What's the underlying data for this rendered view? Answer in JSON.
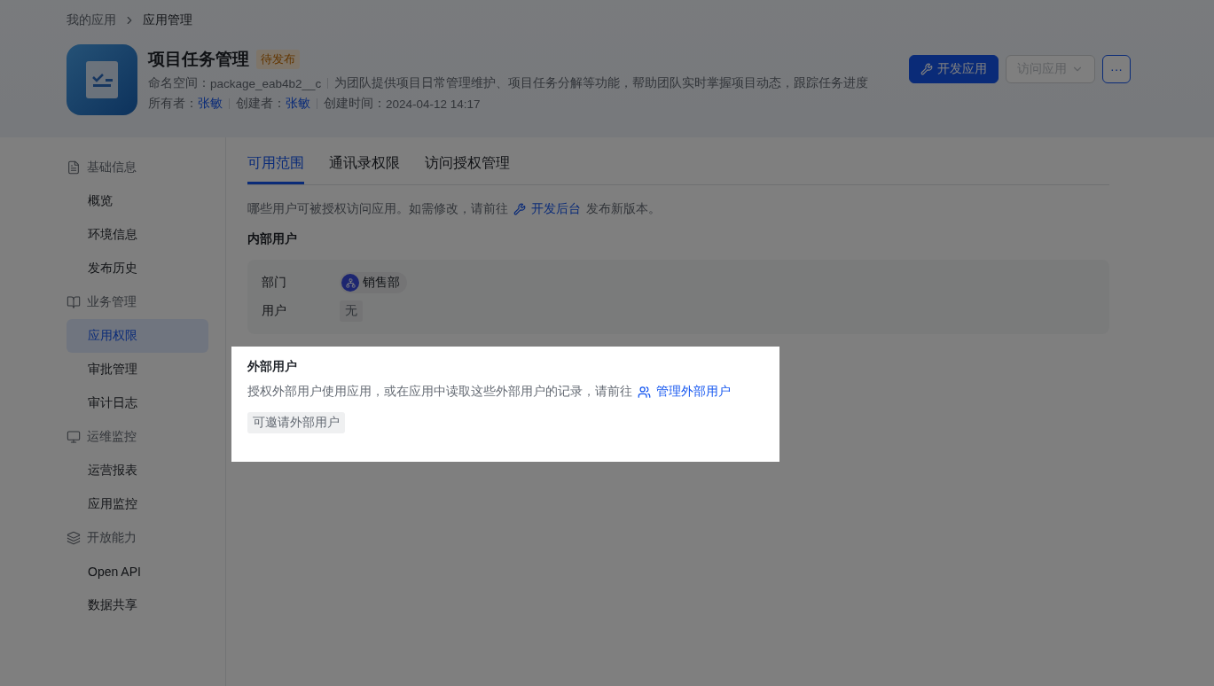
{
  "breadcrumb": [
    "我的应用",
    "应用管理"
  ],
  "app": {
    "name": "项目任务管理",
    "status": "待发布",
    "namespace_label": "命名空间：",
    "namespace": "package_eab4b2__c",
    "description": "为团队提供项目日常管理维护、项目任务分解等功能，帮助团队实时掌握项目动态，跟踪任务进度",
    "owner_label": "所有者：",
    "owner": "张敏",
    "creator_label": "创建者：",
    "creator": "张敏",
    "created_label": "创建时间：",
    "created": "2024-04-12 14:17"
  },
  "actions": [
    {
      "kind": "primary",
      "label": "开发应用",
      "disabled": false
    },
    {
      "kind": "dropdown",
      "label": "访问应用",
      "disabled": true
    },
    {
      "kind": "more",
      "label": "···",
      "disabled": false
    }
  ],
  "sidebar": [
    {
      "kind": "doc",
      "label": "基础信息",
      "items": [
        {
          "label": "概览",
          "selected": false
        },
        {
          "label": "环境信息",
          "selected": false
        },
        {
          "label": "发布历史",
          "selected": false
        }
      ]
    },
    {
      "kind": "book",
      "label": "业务管理",
      "items": [
        {
          "label": "应用权限",
          "selected": true
        },
        {
          "label": "审批管理",
          "selected": false
        },
        {
          "label": "审计日志",
          "selected": false
        }
      ]
    },
    {
      "kind": "monitor",
      "label": "运维监控",
      "items": [
        {
          "label": "运营报表",
          "selected": false
        },
        {
          "label": "应用监控",
          "selected": false
        }
      ]
    },
    {
      "kind": "layers",
      "label": "开放能力",
      "items": [
        {
          "label": "Open API",
          "selected": false
        },
        {
          "label": "数据共享",
          "selected": false
        }
      ]
    }
  ],
  "tabs": [
    {
      "label": "可用范围",
      "selected": true
    },
    {
      "label": "通讯录权限",
      "selected": false
    },
    {
      "label": "访问授权管理",
      "selected": false
    }
  ],
  "intro": {
    "text": "哪些用户可被授权访问应用。如需修改，请前往",
    "link": "开发后台",
    "after": "发布新版本。"
  },
  "internal": {
    "title": "内部用户",
    "rows": [
      {
        "label": "部门",
        "kind": "department",
        "value": "销售部"
      },
      {
        "label": "用户",
        "kind": "plain",
        "value": "无"
      }
    ]
  },
  "external": {
    "title": "外部用户",
    "text": "授权外部用户使用应用，或在应用中读取这些外部用户的记录，请前往",
    "link": "管理外部用户",
    "tag": "可邀请外部用户",
    "highlighted": true
  }
}
